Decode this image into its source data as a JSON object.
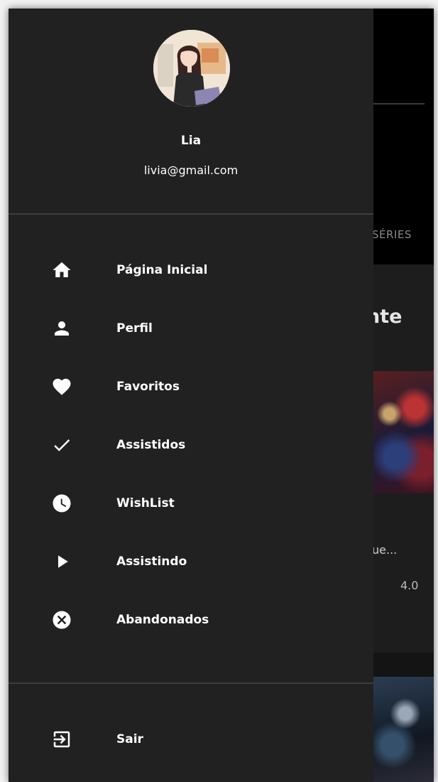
{
  "user": {
    "name": "Lia",
    "email": "livia@gmail.com",
    "avatar_icon": "user-avatar-illustration"
  },
  "menu": {
    "items": [
      {
        "label": "Página Inicial",
        "icon": "home-icon"
      },
      {
        "label": "Perfil",
        "icon": "person-icon"
      },
      {
        "label": "Favoritos",
        "icon": "heart-icon"
      },
      {
        "label": "Assistidos",
        "icon": "check-icon"
      },
      {
        "label": "WishList",
        "icon": "clock-icon"
      },
      {
        "label": "Assistindo",
        "icon": "play-icon"
      },
      {
        "label": "Abandonados",
        "icon": "cancel-icon"
      }
    ],
    "logout": {
      "label": "Sair",
      "icon": "logout-icon"
    }
  },
  "background": {
    "tab_label": "SÉRIES",
    "heading": "nte",
    "item_title": "ue...",
    "rating": "4.0"
  },
  "colors": {
    "drawer": "#212121",
    "divider": "#3d3d3d",
    "text": "#ffffff",
    "page": "#000000"
  }
}
